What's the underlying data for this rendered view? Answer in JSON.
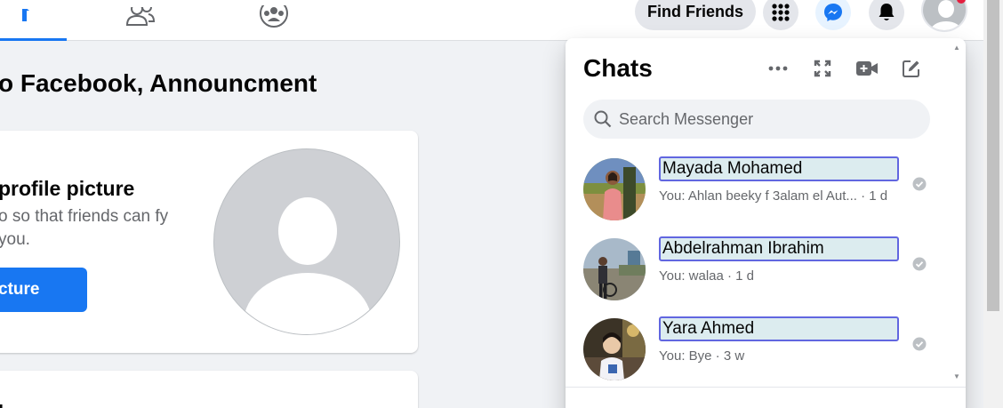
{
  "topbar": {
    "find_friends_label": "Find Friends",
    "icons": [
      "home-icon",
      "friends-icon",
      "groups-icon",
      "menu-grid-icon",
      "messenger-icon",
      "bell-icon",
      "account-avatar"
    ]
  },
  "page": {
    "heading": "o Facebook, Announcment",
    "profile_card": {
      "title": "profile picture",
      "description": "o so that friends can fy you.",
      "button_label": "cture"
    },
    "second_card_title": "h"
  },
  "chats": {
    "title": "Chats",
    "search_placeholder": "Search Messenger",
    "items": [
      {
        "name": "Mayada Mohamed",
        "preview": "You: Ahlan beeky f 3alam el Aut... · 1 d"
      },
      {
        "name": "Abdelrahman Ibrahim",
        "preview": "You: walaa · 1 d"
      },
      {
        "name": "Yara Ahmed",
        "preview": "You: Bye · 3 w"
      }
    ]
  },
  "colors": {
    "brand_blue": "#1877f2",
    "panel_bg": "#ffffff",
    "page_bg": "#f0f2f5",
    "name_highlight": "#dcecef",
    "name_border": "#6166e0"
  }
}
